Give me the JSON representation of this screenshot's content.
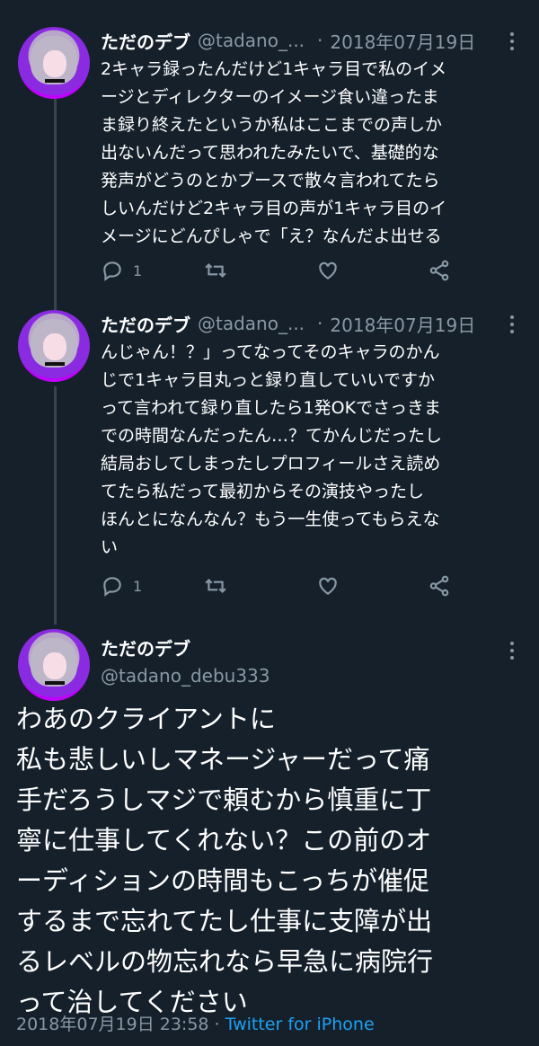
{
  "tweets": [
    {
      "name": "ただのデブ",
      "handle": "@tadano_...",
      "date": "2018年07月19日",
      "text": "2キャラ録ったんだけど1キャラ目で私のイメ\nージとディレクターのイメージ食い違ったま\nま録り終えたというか私はここまでの声しか\n出ないんだって思われたみたいで、基礎的な\n発声がどうのとかブースで散々言われてたら\nしいんだけど2キャラ目の声が1キャラ目のイ\nメージにどんぴしゃで「え？なんだよ出せる",
      "reply_count": "1",
      "retweet_count": "",
      "like_count": ""
    },
    {
      "name": "ただのデブ",
      "handle": "@tadano_...",
      "date": "2018年07月19日",
      "text": "んじゃん！？」ってなってそのキャラのかん\nじで1キャラ目丸っと録り直していいですか\nって言われて録り直したら1発OKでさっきま\nでの時間なんだったん…？てかんじだったし\n結局おしてしまったしプロフィールさえ読め\nてたら私だって最初からその演技やったし\nほんとになんなん？もう一生使ってもらえな\nい",
      "reply_count": "1",
      "retweet_count": "",
      "like_count": ""
    }
  ],
  "main_tweet": {
    "name": "ただのデブ",
    "handle": "@tadano_debu333",
    "text": "わあのクライアントに\n私も悲しいしマネージャーだって痛\n手だろうしマジで頼むから慎重に丁\n寧に仕事してくれない？この前のオ\nーディションの時間もこっちが催促\nするまで忘れてたし仕事に支障が出\nるレベルの物忘れなら早急に病院行\nって治してください",
    "timestamp": "2018年07月19日 23:58 · ",
    "source": "Twitter for iPhone"
  },
  "icons": {
    "reply": "reply-icon",
    "retweet": "retweet-icon",
    "like": "heart-icon",
    "share": "share-icon",
    "more": "more-icon"
  },
  "colors": {
    "background": "#15202b",
    "secondary_text": "#8899a6",
    "link": "#1da1f2",
    "avatar_accent": "#c000ff"
  }
}
